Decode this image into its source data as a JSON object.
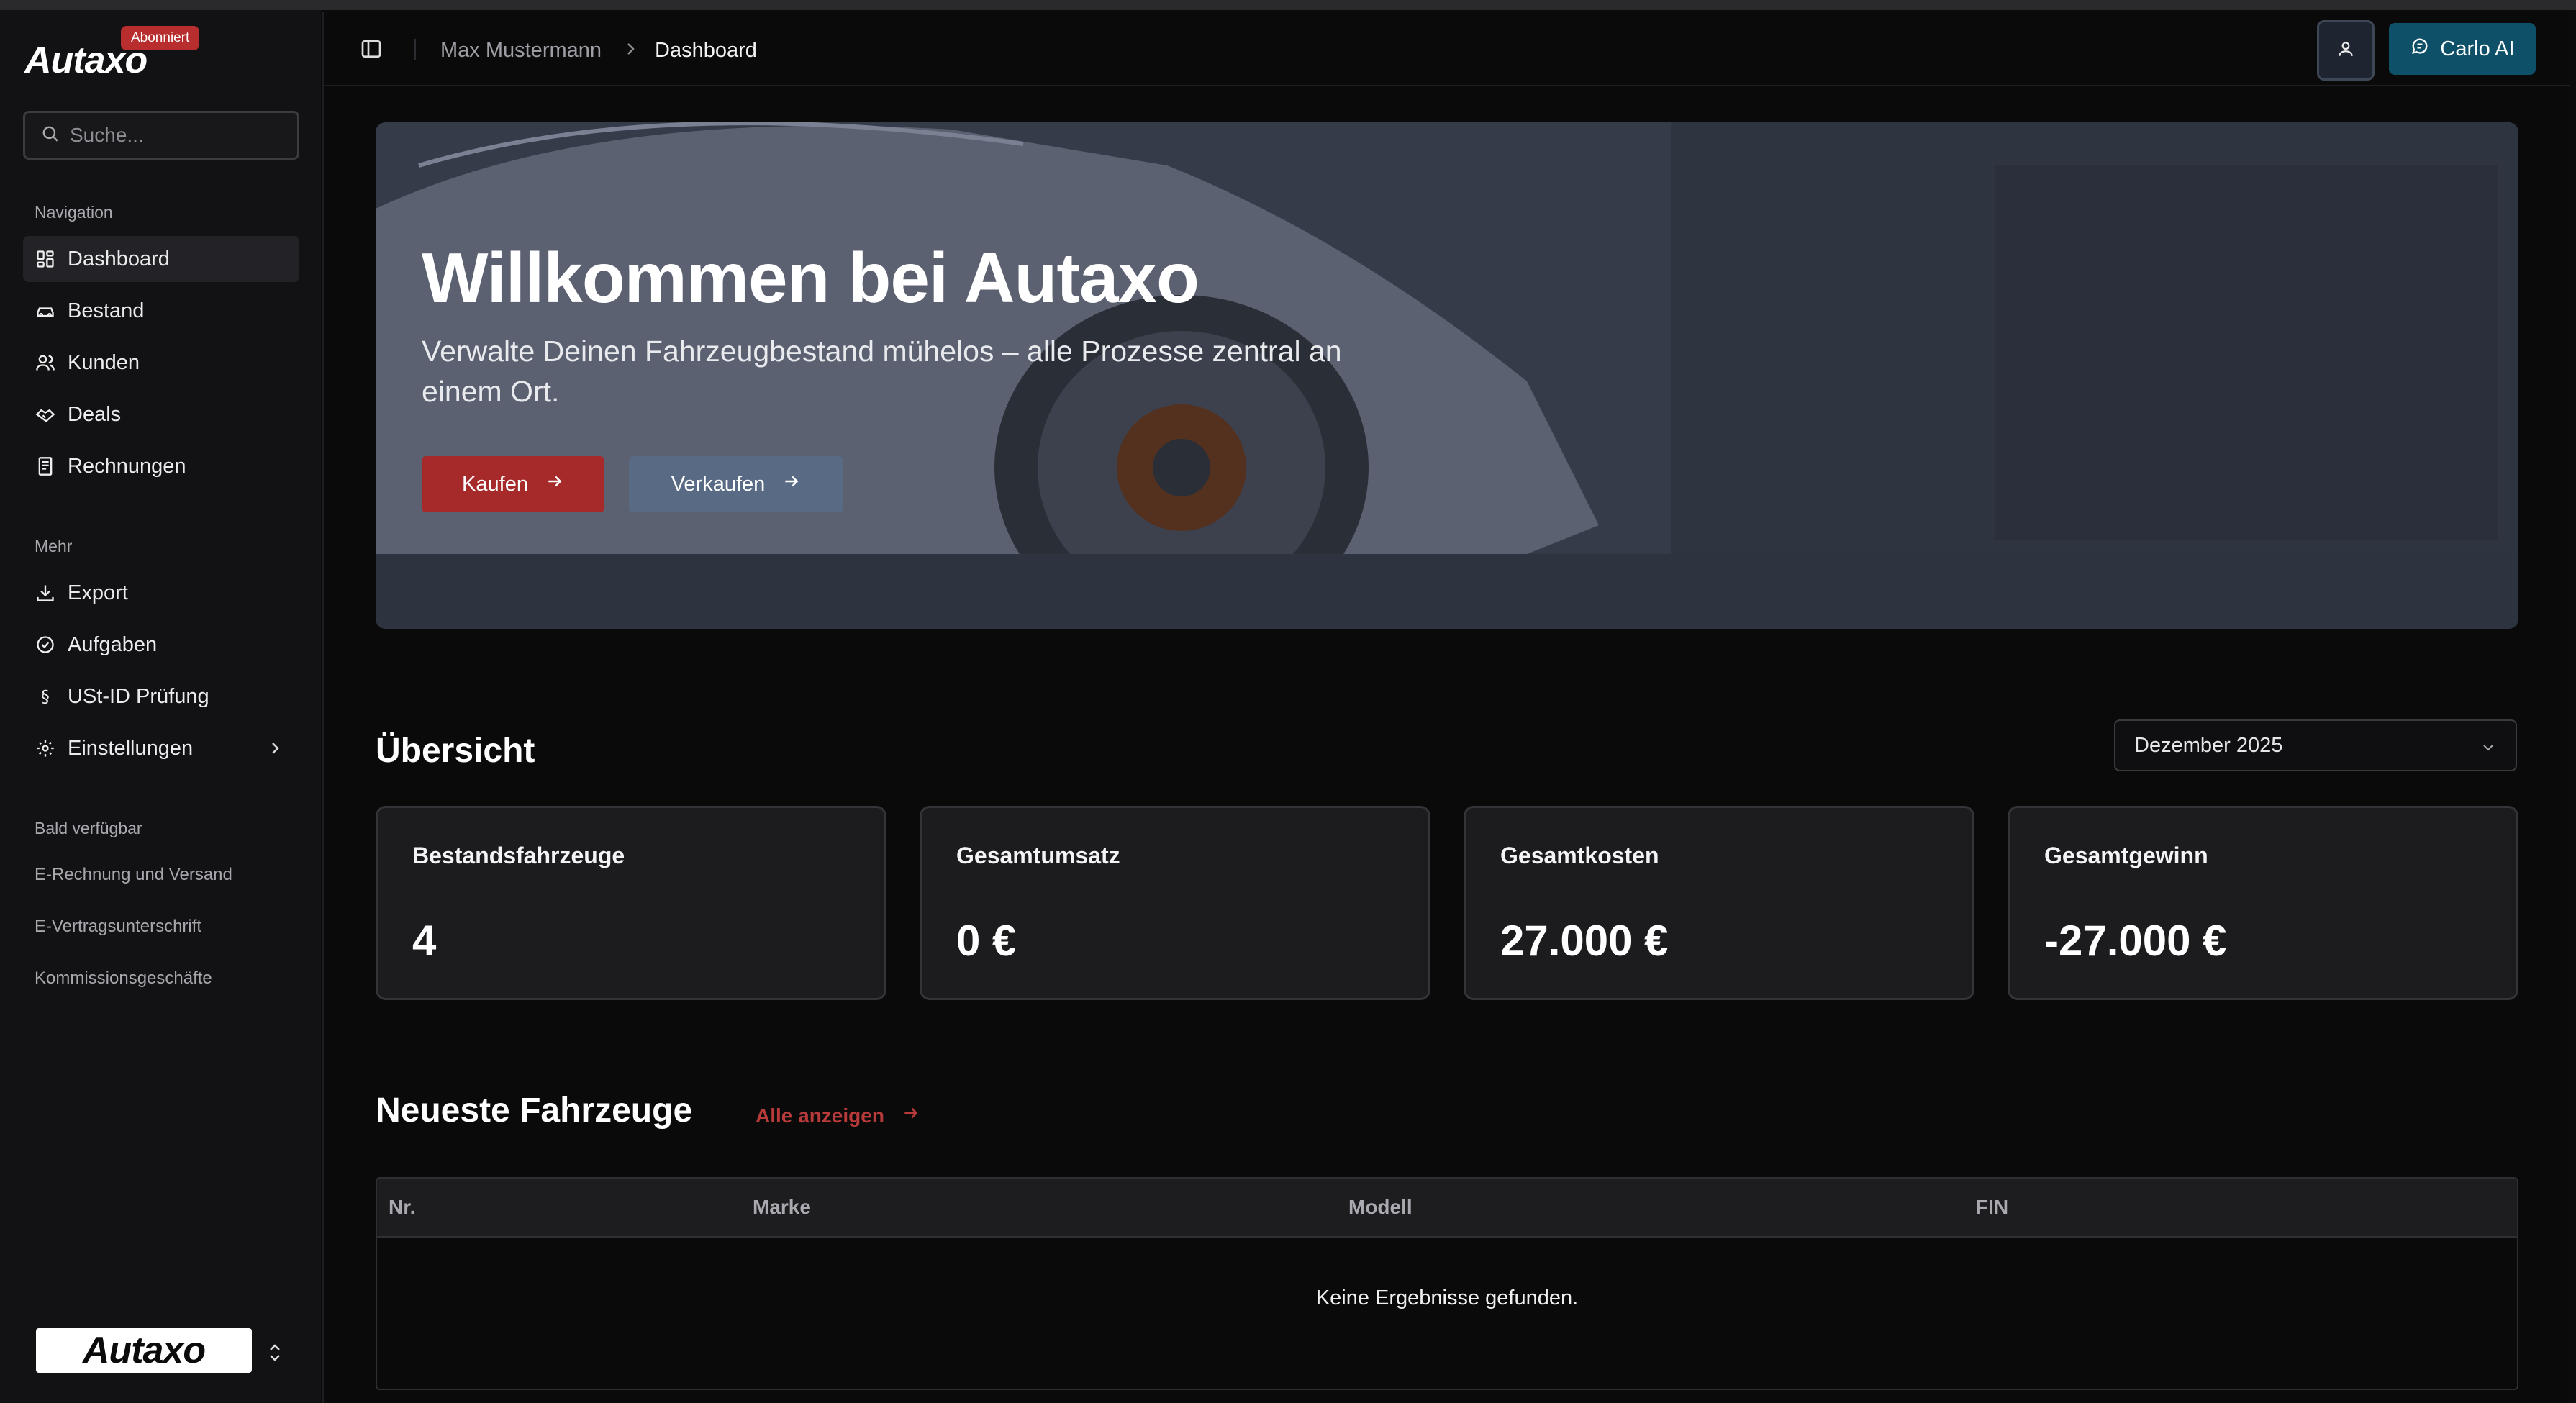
{
  "sidebar": {
    "logo": "Autaxo",
    "badge": "Abonniert",
    "search_placeholder": "Suche...",
    "nav_title": "Navigation",
    "nav_items": [
      {
        "label": "Dashboard",
        "icon": "dashboard-grid-icon"
      },
      {
        "label": "Bestand",
        "icon": "car-icon"
      },
      {
        "label": "Kunden",
        "icon": "users-icon"
      },
      {
        "label": "Deals",
        "icon": "handshake-icon"
      },
      {
        "label": "Rechnungen",
        "icon": "receipt-icon"
      }
    ],
    "more_title": "Mehr",
    "more_items": [
      {
        "label": "Export",
        "icon": "download-icon"
      },
      {
        "label": "Aufgaben",
        "icon": "check-circle-icon"
      },
      {
        "label": "USt-ID Prüfung",
        "icon": "section-sign-icon"
      },
      {
        "label": "Einstellungen",
        "icon": "gear-icon"
      }
    ],
    "soon_title": "Bald verfügbar",
    "soon_items": [
      "E-Rechnung und Versand",
      "E-Vertragsunterschrift",
      "Kommissionsgeschäfte"
    ],
    "footer_logo": "Autaxo"
  },
  "header": {
    "breadcrumb_user": "Max Mustermann",
    "breadcrumb_current": "Dashboard",
    "carlo_label": "Carlo AI"
  },
  "hero": {
    "title": "Willkommen bei Autaxo",
    "subtitle": "Verwalte Deinen Fahrzeugbestand mühelos – alle Prozesse zentral an einem Ort.",
    "buy_label": "Kaufen",
    "sell_label": "Verkaufen"
  },
  "overview": {
    "title": "Übersicht",
    "month": "Dezember 2025",
    "cards": [
      {
        "label": "Bestandsfahrzeuge",
        "value": "4"
      },
      {
        "label": "Gesamtumsatz",
        "value": "0 €"
      },
      {
        "label": "Gesamtkosten",
        "value": "27.000 €"
      },
      {
        "label": "Gesamtgewinn",
        "value": "-27.000 €"
      }
    ]
  },
  "vehicles": {
    "title": "Neueste Fahrzeuge",
    "all_link": "Alle anzeigen",
    "columns": [
      "Nr.",
      "Marke",
      "Modell",
      "FIN"
    ],
    "empty_text": "Keine Ergebnisse gefunden."
  },
  "colors": {
    "accent_red": "#a62a2a",
    "accent_teal": "#0e5068",
    "sidebar_bg": "#121214",
    "main_bg": "#0a0a0b"
  }
}
